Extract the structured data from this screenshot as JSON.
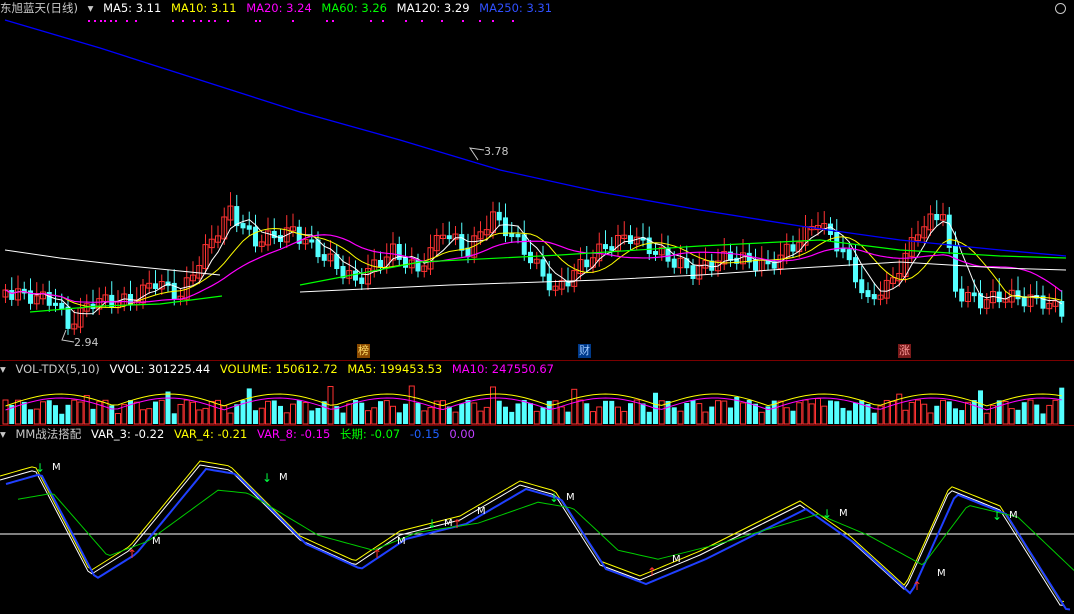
{
  "price": {
    "title": "东旭蓝天(日线)",
    "ma5": "MA5: 3.11",
    "ma10": "MA10: 3.11",
    "ma20": "MA20: 3.24",
    "ma60": "MA60: 3.26",
    "ma120": "MA120: 3.29",
    "ma250": "MA250: 3.31",
    "high_label": "3.78",
    "low_label": "2.94",
    "markers": [
      "榜",
      "财",
      "涨"
    ],
    "colors": {
      "ma5": "#ffffff",
      "ma10": "#ffff00",
      "ma20": "#ff00ff",
      "ma60": "#00ff00",
      "ma120": "#ffffff",
      "ma250": "#0000ff",
      "up": "#ff3232",
      "down": "#54ffff"
    }
  },
  "volume": {
    "name": "VOL-TDX(5,10)",
    "vvol": "VVOL: 301225.44",
    "volume": "VOLUME: 150612.72",
    "ma5": "MA5: 199453.53",
    "ma10": "MA10: 247550.67"
  },
  "indicator": {
    "name": "MM战法搭配",
    "var3": "VAR_3: -0.22",
    "var4": "VAR_4: -0.21",
    "var8": "VAR_8: -0.15",
    "long": "长期: -0.07",
    "v5": "-0.15",
    "v6": "0.00",
    "signal_label": "M"
  }
}
